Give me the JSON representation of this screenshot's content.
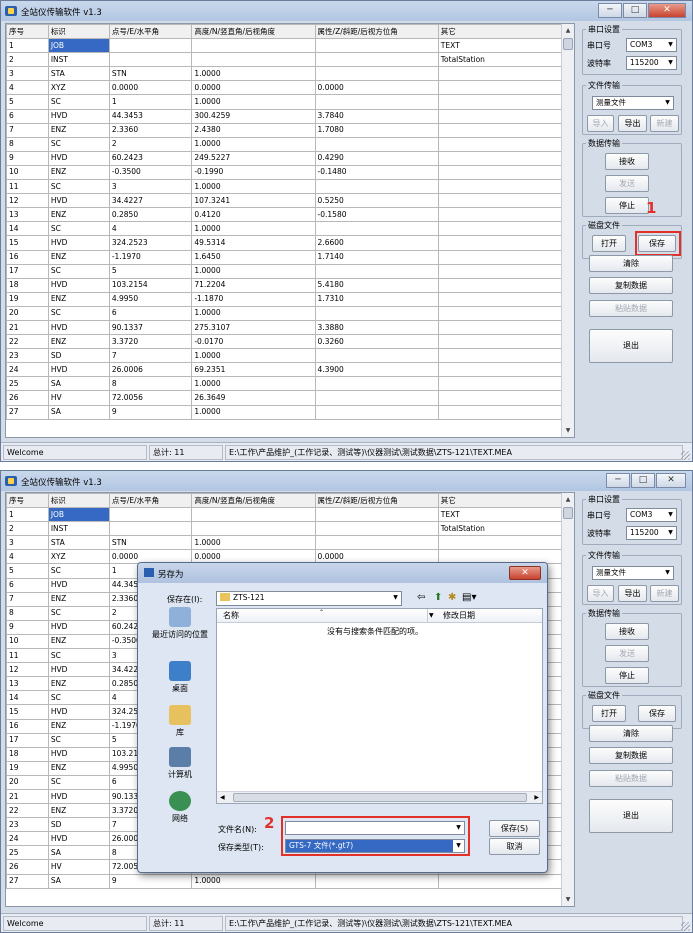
{
  "app": {
    "title": "全站仪传输软件 v1.3",
    "minimize": "─",
    "maximize": "□",
    "close": "✕"
  },
  "columns": [
    "序号",
    "标识",
    "点号/E/水平角",
    "高度/N/竖直角/后视角度",
    "属性/Z/斜距/后视方位角",
    "其它"
  ],
  "rows": [
    [
      "1",
      "JOB",
      "",
      "",
      "",
      "TEXT"
    ],
    [
      "2",
      "INST",
      "",
      "",
      "",
      "TotalStation"
    ],
    [
      "3",
      "STA",
      "STN",
      "1.0000",
      "",
      ""
    ],
    [
      "4",
      "XYZ",
      "0.0000",
      "0.0000",
      "0.0000",
      ""
    ],
    [
      "5",
      "SC",
      "1",
      "1.0000",
      "",
      ""
    ],
    [
      "6",
      "HVD",
      "44.3453",
      "300.4259",
      "3.7840",
      ""
    ],
    [
      "7",
      "ENZ",
      "2.3360",
      "2.4380",
      "1.7080",
      ""
    ],
    [
      "8",
      "SC",
      "2",
      "1.0000",
      "",
      ""
    ],
    [
      "9",
      "HVD",
      "60.2423",
      "249.5227",
      "0.4290",
      ""
    ],
    [
      "10",
      "ENZ",
      "-0.3500",
      "-0.1990",
      "-0.1480",
      ""
    ],
    [
      "11",
      "SC",
      "3",
      "1.0000",
      "",
      ""
    ],
    [
      "12",
      "HVD",
      "34.4227",
      "107.3241",
      "0.5250",
      ""
    ],
    [
      "13",
      "ENZ",
      "0.2850",
      "0.4120",
      "-0.1580",
      ""
    ],
    [
      "14",
      "SC",
      "4",
      "1.0000",
      "",
      ""
    ],
    [
      "15",
      "HVD",
      "324.2523",
      "49.5314",
      "2.6600",
      ""
    ],
    [
      "16",
      "ENZ",
      "-1.1970",
      "1.6450",
      "1.7140",
      ""
    ],
    [
      "17",
      "SC",
      "5",
      "1.0000",
      "",
      ""
    ],
    [
      "18",
      "HVD",
      "103.2154",
      "71.2204",
      "5.4180",
      ""
    ],
    [
      "19",
      "ENZ",
      "4.9950",
      "-1.1870",
      "1.7310",
      ""
    ],
    [
      "20",
      "SC",
      "6",
      "1.0000",
      "",
      ""
    ],
    [
      "21",
      "HVD",
      "90.1337",
      "275.3107",
      "3.3880",
      ""
    ],
    [
      "22",
      "ENZ",
      "3.3720",
      "-0.0170",
      "0.3260",
      ""
    ],
    [
      "23",
      "SD",
      "7",
      "1.0000",
      "",
      ""
    ],
    [
      "24",
      "HVD",
      "26.0006",
      "69.2351",
      "4.3900",
      ""
    ],
    [
      "25",
      "SA",
      "8",
      "1.0000",
      "",
      ""
    ],
    [
      "26",
      "HV",
      "72.0056",
      "26.3649",
      "",
      ""
    ],
    [
      "27",
      "SA",
      "9",
      "1.0000",
      "",
      ""
    ]
  ],
  "panel": {
    "serial_title": "串口设置",
    "port_label": "串口号",
    "port_value": "COM3",
    "baud_label": "波特率",
    "baud_value": "115200",
    "file_title": "文件传输",
    "file_type_value": "测量文件",
    "import": "导入",
    "export": "导出",
    "new": "新建",
    "data_title": "数据传输",
    "receive": "接收",
    "send": "发送",
    "stop": "停止",
    "disk_title": "磁盘文件",
    "open": "打开",
    "save": "保存",
    "clear": "清除",
    "copy": "复制数据",
    "paste": "粘贴数据",
    "exit": "退出"
  },
  "status": {
    "welcome": "Welcome",
    "total": "总计: 11",
    "path": "E:\\工作\\产品维护_(工作记录、测试等)\\仪器测试\\测试数据\\ZTS-121\\TEXT.MEA"
  },
  "annotations": {
    "step1": "1",
    "step2": "2"
  },
  "dialog": {
    "title": "另存为",
    "save_in_label": "保存在(I):",
    "save_in_value": "ZTS-121",
    "places": [
      "最近访问的位置",
      "桌面",
      "库",
      "计算机",
      "网络"
    ],
    "col_name": "名称",
    "col_date": "修改日期",
    "empty_msg": "没有与搜索条件匹配的项。",
    "filename_label": "文件名(N):",
    "filename_value": "",
    "filetype_label": "保存类型(T):",
    "filetype_value": "GTS-7 文件(*.gt7)",
    "save_button": "保存(S)",
    "cancel_button": "取消",
    "close": "✕"
  },
  "colors": {
    "accent": "#3569c3",
    "annotation": "#e3312a"
  }
}
